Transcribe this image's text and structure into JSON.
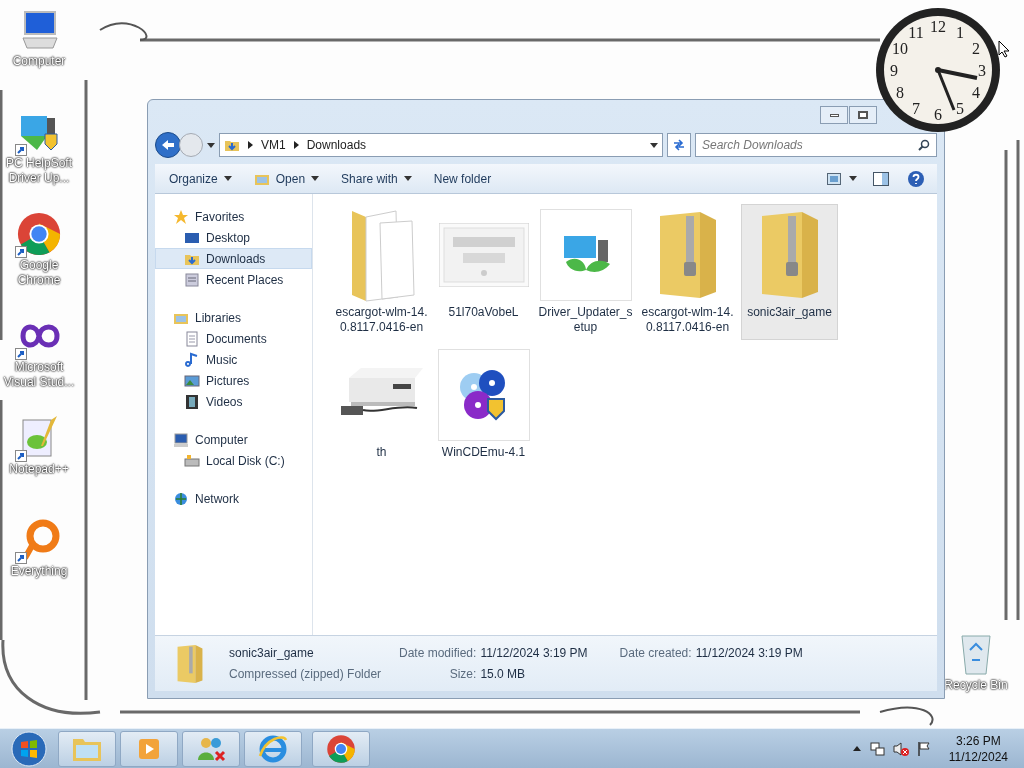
{
  "desktop_icons": [
    {
      "label": "Computer",
      "kind": "computer",
      "shortcut": false
    },
    {
      "label": "PC HelpSoft Driver Up...",
      "kind": "driver",
      "shortcut": true
    },
    {
      "label": "Google Chrome",
      "kind": "chrome",
      "shortcut": true
    },
    {
      "label": "Microsoft Visual Stud...",
      "kind": "vs",
      "shortcut": true
    },
    {
      "label": "Notepad++",
      "kind": "notepad",
      "shortcut": true
    },
    {
      "label": "Everything",
      "kind": "everything",
      "shortcut": true
    }
  ],
  "recycle_bin": {
    "label": "Recycle Bin"
  },
  "clock": {
    "numerals": [
      "12",
      "11",
      "1",
      "10",
      "2",
      "9",
      "3",
      "8",
      "4",
      "7",
      "5",
      "6"
    ]
  },
  "window": {
    "address": [
      "VM1",
      "Downloads"
    ],
    "search": {
      "placeholder": "Search Downloads"
    },
    "toolbar": [
      {
        "label": "Organize",
        "dropdown": true,
        "icon": false
      },
      {
        "label": "Open",
        "dropdown": true,
        "icon": true
      },
      {
        "label": "Share with",
        "dropdown": true,
        "icon": false
      },
      {
        "label": "New folder",
        "dropdown": false,
        "icon": false
      }
    ],
    "nav": [
      {
        "label": "Favorites",
        "kind": "star",
        "children": [
          {
            "label": "Desktop",
            "kind": "desktop",
            "selected": false
          },
          {
            "label": "Downloads",
            "kind": "downloads",
            "selected": true
          },
          {
            "label": "Recent Places",
            "kind": "recent",
            "selected": false
          }
        ]
      },
      {
        "label": "Libraries",
        "kind": "libraries",
        "children": [
          {
            "label": "Documents",
            "kind": "documents",
            "selected": false
          },
          {
            "label": "Music",
            "kind": "music",
            "selected": false
          },
          {
            "label": "Pictures",
            "kind": "pictures",
            "selected": false
          },
          {
            "label": "Videos",
            "kind": "videos",
            "selected": false
          }
        ]
      },
      {
        "label": "Computer",
        "kind": "computer",
        "children": [
          {
            "label": "Local Disk (C:)",
            "kind": "disk",
            "selected": false
          }
        ]
      },
      {
        "label": "Network",
        "kind": "network"
      }
    ],
    "files": [
      {
        "name": "escargot-wlm-14.0.8117.0416-en",
        "kind": "folder",
        "selected": false
      },
      {
        "name": "51l70aVobeL",
        "kind": "picture",
        "selected": false
      },
      {
        "name": "Driver_Updater_setup",
        "kind": "installer",
        "selected": false
      },
      {
        "name": "escargot-wlm-14.0.8117.0416-en",
        "kind": "zip",
        "selected": false
      },
      {
        "name": "sonic3air_game",
        "kind": "zip",
        "selected": true
      },
      {
        "name": "th",
        "kind": "picture",
        "selected": false
      },
      {
        "name": "WinCDEmu-4.1",
        "kind": "discs",
        "selected": false
      }
    ],
    "details": {
      "name": "sonic3air_game",
      "type": "Compressed (zipped) Folder",
      "fields": [
        {
          "label": "Date modified:",
          "value": "11/12/2024 3:19 PM"
        },
        {
          "label": "Date created:",
          "value": "11/12/2024 3:19 PM"
        },
        {
          "label": "Size:",
          "value": "15.0 MB"
        }
      ]
    }
  },
  "taskbar": {
    "apps": [
      {
        "kind": "explorer"
      },
      {
        "kind": "media"
      },
      {
        "kind": "people"
      },
      {
        "kind": "ie"
      },
      {
        "kind": "chrome"
      }
    ],
    "time": "3:26 PM",
    "date": "11/12/2024"
  }
}
